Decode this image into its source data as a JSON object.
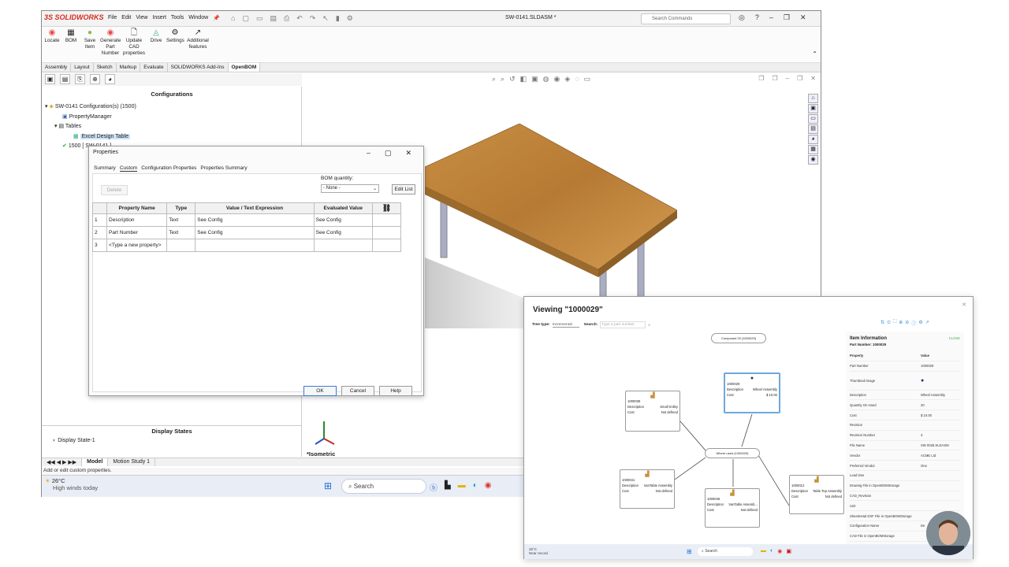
{
  "sw": {
    "logo": "3S SOLIDWORKS",
    "menu": [
      "File",
      "Edit",
      "View",
      "Insert",
      "Tools",
      "Window"
    ],
    "doc_title": "SW-0141.SLDASM *",
    "search_placeholder": "Search Commands",
    "ribbon": [
      {
        "label": "Locate",
        "icon": "locate-icon"
      },
      {
        "label": "BOM",
        "icon": "bom-icon"
      },
      {
        "label": "Save Item",
        "icon": "save-item-icon"
      },
      {
        "label": "Generate Part Number",
        "icon": "generate-icon"
      },
      {
        "label": "Update CAD properties",
        "icon": "update-icon"
      },
      {
        "label": "Drive",
        "icon": "drive-icon"
      },
      {
        "label": "Settings",
        "icon": "gear-icon"
      },
      {
        "label": "Additional features",
        "icon": "features-icon"
      }
    ],
    "tabs": [
      "Assembly",
      "Layout",
      "Sketch",
      "Markup",
      "Evaluate",
      "SOLIDWORKS Add-Ins",
      "OpenBOM"
    ],
    "active_tab": "OpenBOM",
    "configurations_title": "Configurations",
    "tree": {
      "root": "SW-0141 Configuration(s) (1500)",
      "property_manager": "PropertyManager",
      "tables": "Tables",
      "excel": "Excel Design Table",
      "config1": "1500 [ SW-0141 ]"
    },
    "display_states_title": "Display States",
    "display_state": "Display State-1",
    "view_name": "*Isometric",
    "bottom_tabs": [
      "Model",
      "Motion Study 1"
    ],
    "status": "Add or edit custom properties.",
    "weather_temp": "26°C",
    "weather_text": "High winds today",
    "taskbar_search": "Search"
  },
  "dialog": {
    "title": "Properties",
    "tabs": [
      "Summary",
      "Custom",
      "Configuration Properties",
      "Properties Summary"
    ],
    "active_tab": "Custom",
    "delete_label": "Delete",
    "bom_quantity_label": "BOM quantity:",
    "bom_quantity_value": "- None -",
    "edit_list": "Edit List",
    "columns": [
      "Property Name",
      "Type",
      "Value / Text Expression",
      "Evaluated Value"
    ],
    "rows": [
      {
        "n": "1",
        "name": "Description",
        "type": "Text",
        "value": "See Config",
        "evaluated": "See Config"
      },
      {
        "n": "2",
        "name": "Part Number",
        "type": "Text",
        "value": "See Config",
        "evaluated": "See Config"
      },
      {
        "n": "3",
        "name": "<Type a new property>",
        "type": "",
        "value": "",
        "evaluated": ""
      }
    ],
    "ok": "OK",
    "cancel": "Cancel",
    "help": "Help"
  },
  "openbom": {
    "title": "Viewing \"1000029\"",
    "tree_type_label": "Tree type:",
    "tree_type_value": "Incremental",
    "search_label": "Search:",
    "search_placeholder": "Type a part number",
    "composed_of": "Composed Of (1000029)",
    "where_used": "Where used (1000029)",
    "nodes": [
      {
        "id": "1000029",
        "desc": "Wheel Assembly",
        "cost": "$ 10.00"
      },
      {
        "id": "1000036",
        "desc": "Small trolley",
        "cost": "Not defined"
      },
      {
        "id": "1000041",
        "desc": "VanTable Assembly",
        "cost": "Not defined"
      },
      {
        "id": "1000046",
        "desc": "VanTable Assemb...",
        "cost": "Not defined"
      },
      {
        "id": "1000012",
        "desc": "Table Top Assembly",
        "cost": "Not defined"
      }
    ],
    "node_desc_label": "Description",
    "node_cost_label": "Cost",
    "item_info_title": "Item Information",
    "close": "CLOSE",
    "part_number_header": "Part Number: 1000029",
    "col_property": "Property",
    "col_value": "Value",
    "props": [
      {
        "k": "Part Number",
        "v": "1000029"
      },
      {
        "k": "Thumbnail image",
        "v": ""
      },
      {
        "k": "Description",
        "v": "Wheel Assembly"
      },
      {
        "k": "Quantity On Hand",
        "v": "20"
      },
      {
        "k": "Cost",
        "v": "$ 10.00"
      },
      {
        "k": "Revision",
        "v": ""
      },
      {
        "k": "Revision Number",
        "v": "3"
      },
      {
        "k": "File Name",
        "v": "SW 0026.SLDASM"
      },
      {
        "k": "Vendor",
        "v": "ACME Ltd"
      },
      {
        "k": "Preferred Vendor",
        "v": "One"
      },
      {
        "k": "Lead time",
        "v": ""
      },
      {
        "k": "Drawing File in OpenBOMStorage",
        "v": ""
      },
      {
        "k": "CAD_Revision",
        "v": ""
      },
      {
        "k": "Unit",
        "v": ""
      },
      {
        "k": "Sheetmetal DXF File in OpenBOMStorage",
        "v": ""
      },
      {
        "k": "Configuration Name",
        "v": "De"
      },
      {
        "k": "CAD File in OpenBOMStorage",
        "v": ""
      }
    ],
    "taskbar_search": "Search",
    "weather": "26°C",
    "weather_sub": "Near record"
  }
}
